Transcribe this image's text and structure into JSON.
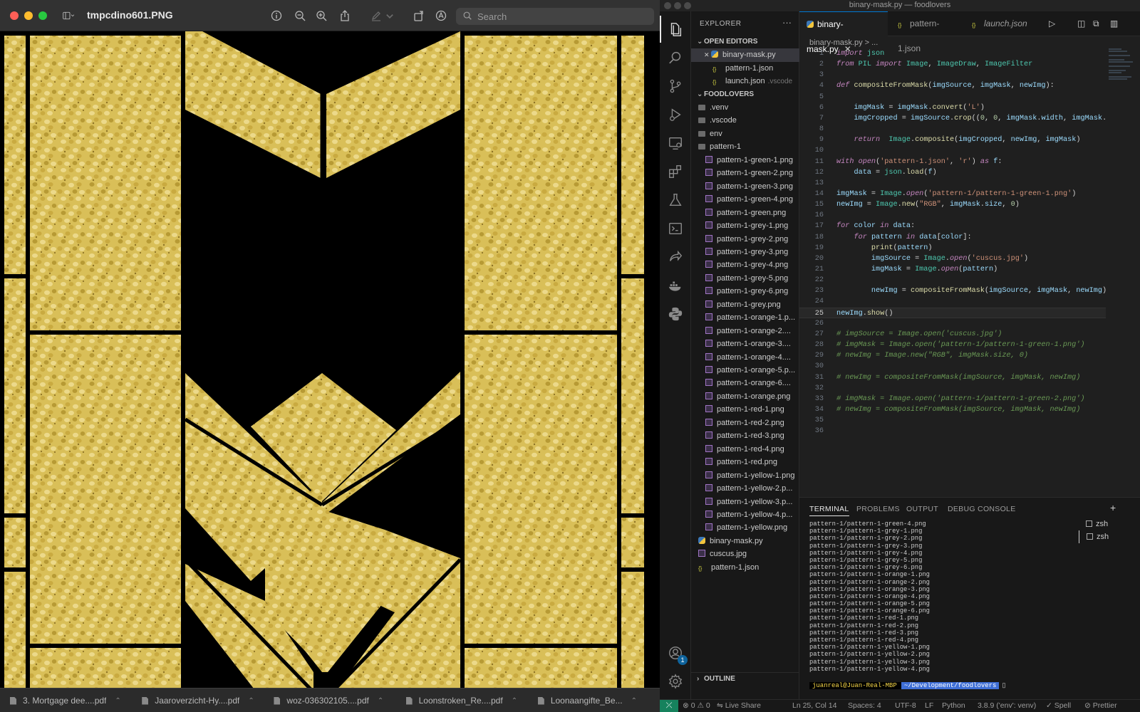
{
  "preview": {
    "title": "tmpcdino601.PNG",
    "search_placeholder": "Search",
    "toolbar_icons": [
      "sidebar-toggle-icon",
      "info-icon",
      "zoom-out-icon",
      "zoom-in-icon",
      "share-icon",
      "markup-pen-icon",
      "rotate-icon",
      "annotate-icon"
    ]
  },
  "downloads": [
    {
      "name": "3. Mortgage dee....pdf"
    },
    {
      "name": "Jaaroverzicht-Hy....pdf"
    },
    {
      "name": "woz-036302105....pdf"
    },
    {
      "name": "Loonstroken_Re....pdf"
    },
    {
      "name": "Loonaangifte_Be..."
    }
  ],
  "vscode": {
    "window_title": "binary-mask.py — foodlovers",
    "explorer_label": "EXPLORER",
    "open_editors_label": "OPEN EDITORS",
    "open_editors": [
      {
        "name": "binary-mask.py",
        "type": "py"
      },
      {
        "name": "pattern-1.json",
        "type": "json"
      },
      {
        "name": "launch.json",
        "type": "json",
        "hint": ".vscode"
      }
    ],
    "project_label": "FOODLOVERS",
    "folders": [
      ".venv",
      ".vscode",
      "env",
      "pattern-1"
    ],
    "pattern_files": [
      "pattern-1-green-1.png",
      "pattern-1-green-2.png",
      "pattern-1-green-3.png",
      "pattern-1-green-4.png",
      "pattern-1-green.png",
      "pattern-1-grey-1.png",
      "pattern-1-grey-2.png",
      "pattern-1-grey-3.png",
      "pattern-1-grey-4.png",
      "pattern-1-grey-5.png",
      "pattern-1-grey-6.png",
      "pattern-1-grey.png",
      "pattern-1-orange-1.p...",
      "pattern-1-orange-2....",
      "pattern-1-orange-3....",
      "pattern-1-orange-4....",
      "pattern-1-orange-5.p...",
      "pattern-1-orange-6....",
      "pattern-1-orange.png",
      "pattern-1-red-1.png",
      "pattern-1-red-2.png",
      "pattern-1-red-3.png",
      "pattern-1-red-4.png",
      "pattern-1-red.png",
      "pattern-1-yellow-1.png",
      "pattern-1-yellow-2.p...",
      "pattern-1-yellow-3.p...",
      "pattern-1-yellow-4.p...",
      "pattern-1-yellow.png"
    ],
    "root_files": [
      {
        "name": "binary-mask.py",
        "type": "py"
      },
      {
        "name": "cuscus.jpg",
        "type": "img"
      },
      {
        "name": "pattern-1.json",
        "type": "json"
      }
    ],
    "outline_label": "OUTLINE",
    "tabs": [
      {
        "label": "binary-mask.py",
        "type": "py"
      },
      {
        "label": "pattern-1.json",
        "type": "json"
      },
      {
        "label": "launch.json",
        "type": "json"
      }
    ],
    "breadcrumb": "binary-mask.py > ...",
    "current_line": 25,
    "code": [
      "import json",
      "from PIL import Image, ImageDraw, ImageFilter",
      "",
      "def compositeFromMask(imgSource, imgMask, newImg):",
      "",
      "    imgMask = imgMask.convert('L')",
      "    imgCropped = imgSource.crop((0, 0, imgMask.width, imgMask.",
      "",
      "    return  Image.composite(imgCropped, newImg, imgMask)",
      "",
      "with open('pattern-1.json', 'r') as f:",
      "    data = json.load(f)",
      "",
      "imgMask = Image.open('pattern-1/pattern-1-green-1.png')",
      "newImg = Image.new(\"RGB\", imgMask.size, 0)",
      "",
      "for color in data:",
      "    for pattern in data[color]:",
      "        print(pattern)",
      "        imgSource = Image.open('cuscus.jpg')",
      "        imgMask = Image.open(pattern)",
      "",
      "        newImg = compositeFromMask(imgSource, imgMask, newImg)",
      "",
      "newImg.show()",
      "",
      "# imgSource = Image.open('cuscus.jpg')",
      "# imgMask = Image.open('pattern-1/pattern-1-green-1.png')",
      "# newImg = Image.new(\"RGB\", imgMask.size, 0)",
      "",
      "# newImg = compositeFromMask(imgSource, imgMask, newImg)",
      "",
      "# imgMask = Image.open('pattern-1/pattern-1-green-2.png')",
      "# newImg = compositeFromMask(imgSource, imgMask, newImg)",
      "",
      ""
    ],
    "panel_tabs": [
      "TERMINAL",
      "PROBLEMS",
      "OUTPUT",
      "DEBUG CONSOLE"
    ],
    "terminal_lines": [
      "pattern-1/pattern-1-green-4.png",
      "pattern-1/pattern-1-grey-1.png",
      "pattern-1/pattern-1-grey-2.png",
      "pattern-1/pattern-1-grey-3.png",
      "pattern-1/pattern-1-grey-4.png",
      "pattern-1/pattern-1-grey-5.png",
      "pattern-1/pattern-1-grey-6.png",
      "pattern-1/pattern-1-orange-1.png",
      "pattern-1/pattern-1-orange-2.png",
      "pattern-1/pattern-1-orange-3.png",
      "pattern-1/pattern-1-orange-4.png",
      "pattern-1/pattern-1-orange-5.png",
      "pattern-1/pattern-1-orange-6.png",
      "pattern-1/pattern-1-red-1.png",
      "pattern-1/pattern-1-red-2.png",
      "pattern-1/pattern-1-red-3.png",
      "pattern-1/pattern-1-red-4.png",
      "pattern-1/pattern-1-yellow-1.png",
      "pattern-1/pattern-1-yellow-2.png",
      "pattern-1/pattern-1-yellow-3.png",
      "pattern-1/pattern-1-yellow-4.png"
    ],
    "prompt_user": "juanreal@Juan-Real-MBP",
    "prompt_path": "~/Development/foodlovers",
    "shells": [
      "zsh",
      "zsh"
    ],
    "accounts_badge": "1",
    "status": {
      "errors": "0",
      "warnings": "0",
      "live_share": "Live Share",
      "position": "Ln 25, Col 14",
      "spaces": "Spaces: 4",
      "encoding": "UTF-8",
      "eol": "LF",
      "language": "Python",
      "interpreter": "3.8.9 ('env': venv)",
      "spell": "Spell",
      "prettier": "Prettier"
    }
  },
  "colors": {
    "couscous": "#d9bf58",
    "couscous_dark": "#b79a34",
    "couscous_light": "#ecd98a",
    "mask_black": "#000000",
    "vscode_accent": "#0078d4",
    "keyword": "#c586c0",
    "function": "#dcdcaa",
    "string": "#ce9178",
    "comment": "#6a9955",
    "number": "#b5cea8",
    "variable": "#9cdcfe"
  }
}
